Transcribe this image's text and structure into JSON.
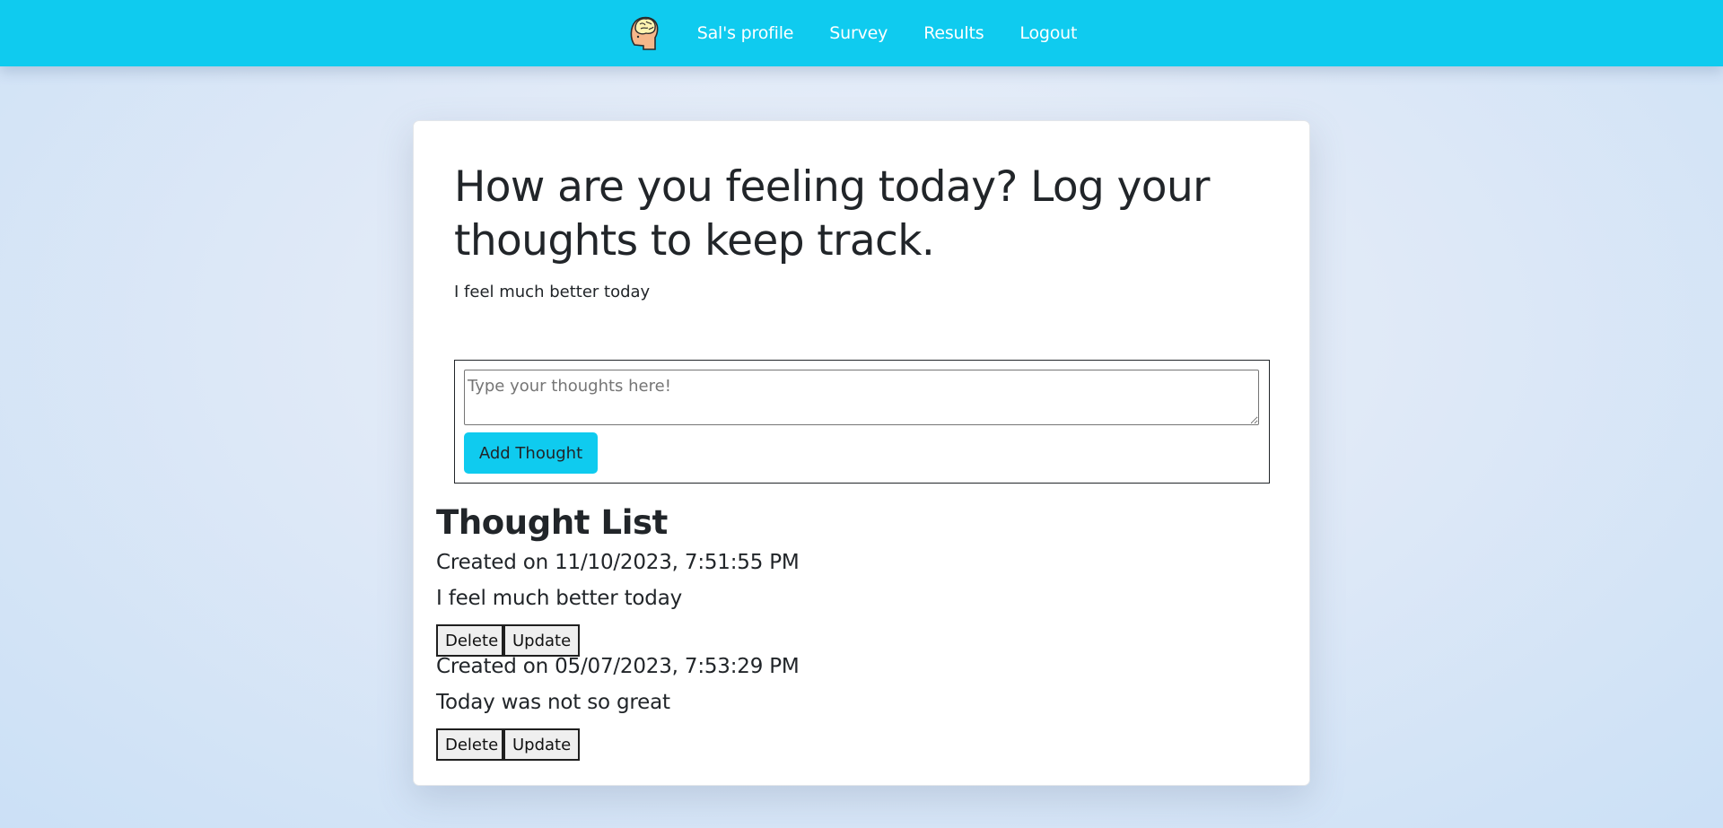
{
  "nav": {
    "logo_icon": "brain-head-icon",
    "links": [
      {
        "label": "Sal's profile"
      },
      {
        "label": "Survey"
      },
      {
        "label": "Results"
      },
      {
        "label": "Logout"
      }
    ],
    "accent_color": "#0fcbef"
  },
  "main": {
    "title": "How are you feeling today? Log your thoughts to keep track.",
    "latest_thought": "I feel much better today",
    "form": {
      "placeholder": "Type your thoughts here!",
      "value": "",
      "submit_label": "Add Thought"
    },
    "list_title": "Thought List",
    "thoughts": [
      {
        "created": "Created on 11/10/2023, 7:51:55 PM",
        "text": "I feel much better today",
        "delete_label": "Delete",
        "update_label": "Update"
      },
      {
        "created": "Created on 05/07/2023, 7:53:29 PM",
        "text": "Today was not so great",
        "delete_label": "Delete",
        "update_label": "Update"
      }
    ]
  }
}
